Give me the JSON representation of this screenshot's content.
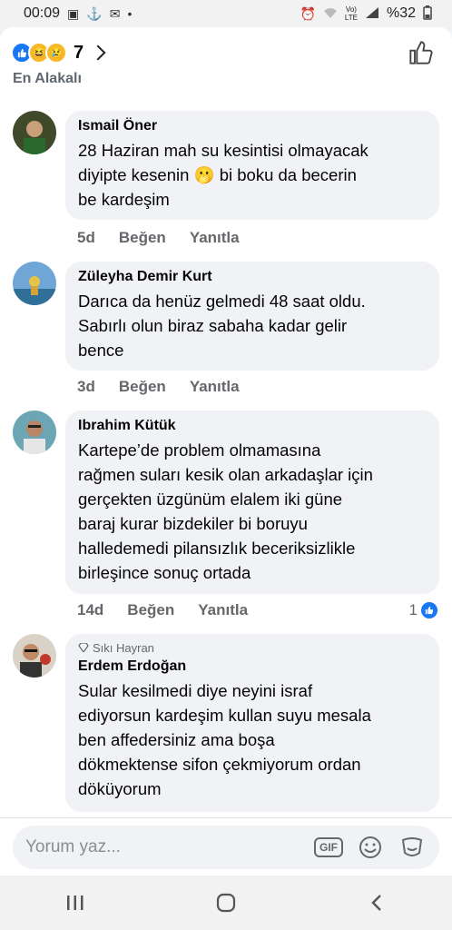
{
  "status_bar": {
    "time": "00:09",
    "battery": "%32",
    "network": "LTE"
  },
  "top_bar": {
    "reaction_count": "7"
  },
  "sort_label": "En Alakalı",
  "comments": [
    {
      "author": "Ismail Öner",
      "text_lines": [
        "28 Haziran mah su kesintisi olmayacak",
        "diyipte kesenin 🫢 bi boku da becerin",
        "be kardeşim"
      ],
      "time": "5d",
      "like": "Beğen",
      "reply": "Yanıtla"
    },
    {
      "author": "Züleyha Demir Kurt",
      "text_lines": [
        "Darıca da henüz gelmedi 48 saat oldu.",
        "Sabırlı olun biraz sabaha kadar gelir",
        "bence"
      ],
      "time": "3d",
      "like": "Beğen",
      "reply": "Yanıtla"
    },
    {
      "author": "Ibrahim Kütük",
      "text_lines": [
        "Kartepe’de problem olmamasına",
        "rağmen suları kesik olan arkadaşlar için",
        "gerçekten üzgünüm elalem iki güne",
        "baraj kurar bizdekiler bi boruyu",
        "halledemedi pilansızlık beceriksizlikle",
        "birleşince sonuç ortada"
      ],
      "time": "14d",
      "like": "Beğen",
      "reply": "Yanıtla",
      "reaction_count": "1"
    },
    {
      "badge": "Sıkı Hayran",
      "author": "Erdem Erdoğan",
      "text_lines": [
        "Sular kesilmedi diye neyini israf",
        "ediyorsun kardeşim kullan suyu mesala",
        "ben affedersiniz ama boşa",
        "dökmektense sifon çekmiyorum ordan",
        "döküyorum"
      ]
    }
  ],
  "composer": {
    "placeholder": "Yorum yaz...",
    "gif_label": "GIF"
  },
  "colors": {
    "brand_blue": "#1877f2",
    "bubble_bg": "#f0f2f5",
    "meta_text": "#65676b"
  }
}
